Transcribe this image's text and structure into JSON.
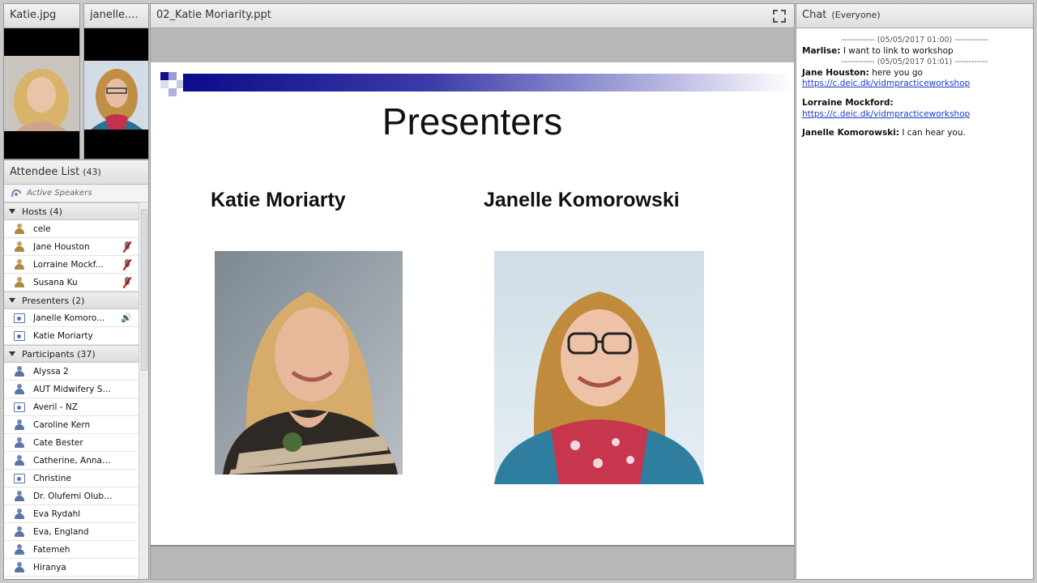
{
  "cams": [
    {
      "title": "Katie.jpg"
    },
    {
      "title": "janelle...."
    }
  ],
  "attendees": {
    "title": "Attendee List",
    "count": "(43)",
    "active_speakers": "Active Speakers",
    "groups": [
      {
        "label": "Hosts (4)",
        "members": [
          {
            "name": "cele",
            "muted": false
          },
          {
            "name": "Jane Houston",
            "muted": true
          },
          {
            "name": "Lorraine Mockf...",
            "muted": true
          },
          {
            "name": "Susana Ku",
            "muted": true
          }
        ]
      },
      {
        "label": "Presenters (2)",
        "members": [
          {
            "name": "Janelle Komoro...",
            "speaking": true
          },
          {
            "name": "Katie Moriarty"
          }
        ]
      },
      {
        "label": "Participants (37)",
        "members": [
          {
            "name": "Alyssa 2"
          },
          {
            "name": "AUT Midwifery Scho..."
          },
          {
            "name": "Averil - NZ"
          },
          {
            "name": "Caroline Kern"
          },
          {
            "name": "Cate Bester"
          },
          {
            "name": "Catherine, Annapolis..."
          },
          {
            "name": "Christine"
          },
          {
            "name": "Dr. Olufemi Olubodun"
          },
          {
            "name": "Eva Rydahl"
          },
          {
            "name": "Eva, England"
          },
          {
            "name": "Fatemeh"
          },
          {
            "name": "Hiranya"
          }
        ]
      }
    ]
  },
  "share": {
    "title": "02_Katie Moriarity.ppt",
    "slide_title": "Presenters",
    "presenter1": "Katie Moriarty",
    "presenter2": "Janelle Komorowski"
  },
  "chat": {
    "title": "Chat",
    "scope": "(Everyone)",
    "sep1": "------------ (05/05/2017 01:00) ------------",
    "msg1_author": "Marlise:",
    "msg1_text": "I want to link to workshop",
    "sep2": "------------ (05/05/2017 01:01) ------------",
    "msg2_author": "Jane Houston:",
    "msg2_text": "here you go",
    "msg2_link": "https://c.deic.dk/vidmpracticeworkshop",
    "msg3_author": "Lorraine Mockford:",
    "msg3_link": "https://c.deic.dk/vidmpracticeworkshop",
    "msg4_author": "Janelle Komorowski:",
    "msg4_text": "I can hear you."
  }
}
